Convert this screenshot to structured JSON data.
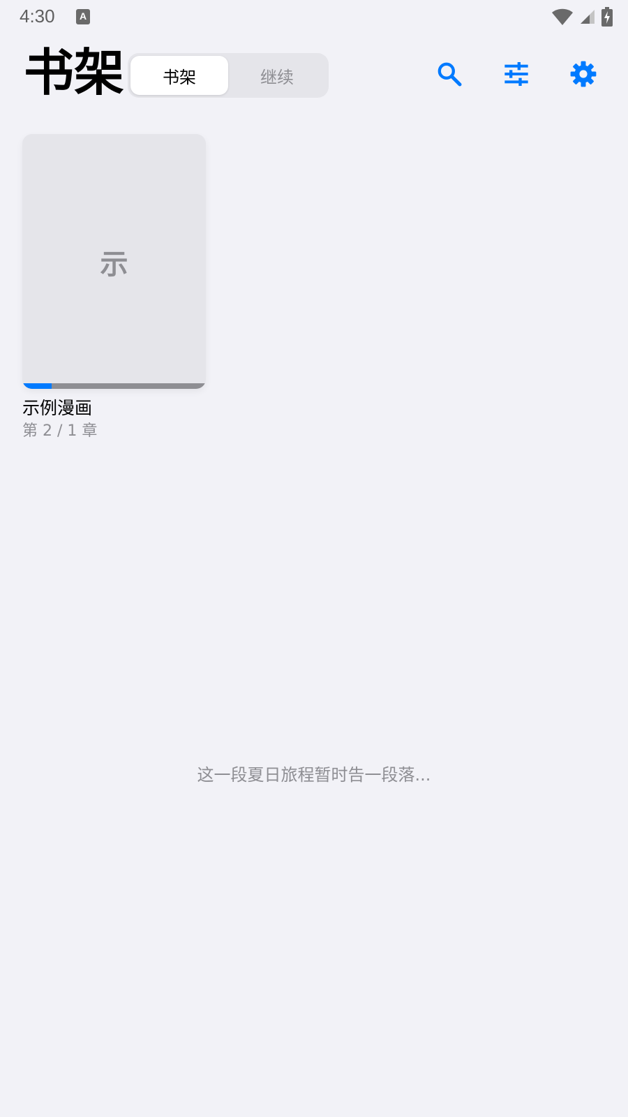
{
  "status_bar": {
    "time": "4:30",
    "notification_icon_letter": "A",
    "icons": [
      "wifi-icon",
      "cell-signal-icon",
      "battery-charging-icon"
    ]
  },
  "header": {
    "title": "书架",
    "tabs": [
      {
        "label": "书架",
        "active": true
      },
      {
        "label": "继续",
        "active": false
      }
    ],
    "actions": [
      "search-icon",
      "tune-icon",
      "settings-icon"
    ],
    "accent_color": "#007aff"
  },
  "library": {
    "books": [
      {
        "cover_initial": "示",
        "title": "示例漫画",
        "chapter_info": "第 2 / 1 章",
        "progress_fraction": 0.16
      }
    ]
  },
  "footer_message": "这一段夏日旅程暂时告一段落..."
}
